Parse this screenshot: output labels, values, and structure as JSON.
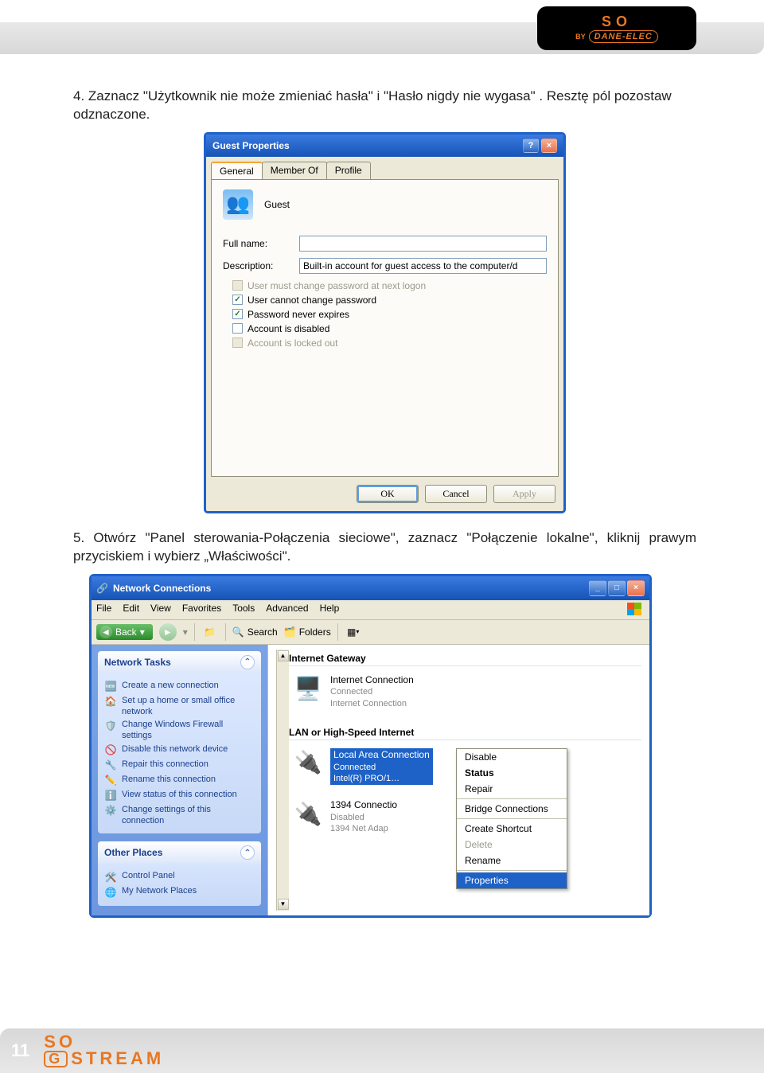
{
  "page_number": "11",
  "header_logo": {
    "so": "SO",
    "by": "BY",
    "brand": "DANE-ELEC"
  },
  "footer_logo": {
    "so": "SO",
    "g": "G",
    "stream": "STREAM"
  },
  "instruction4": "4. Zaznacz \"Użytkownik nie może zmieniać hasła\" i \"Hasło nigdy nie wygasa\" . Resztę pól pozostaw odznaczone.",
  "instruction5": "5. Otwórz \"Panel sterowania-Połączenia sieciowe\", zaznacz \"Połączenie lokalne\", kliknij prawym przyciskiem i wybierz „Właściwości\".",
  "guest_dialog": {
    "title": "Guest Properties",
    "tabs": {
      "general": "General",
      "member": "Member Of",
      "profile": "Profile"
    },
    "user_label": "Guest",
    "full_name_label": "Full name:",
    "full_name_value": "",
    "description_label": "Description:",
    "description_value": "Built-in account for guest access to the computer/d",
    "cb1": "User must change password at next logon",
    "cb2": "User cannot change password",
    "cb3": "Password never expires",
    "cb4": "Account is disabled",
    "cb5": "Account is locked out",
    "ok": "OK",
    "cancel": "Cancel",
    "apply": "Apply"
  },
  "nc": {
    "title": "Network Connections",
    "menu": {
      "file": "File",
      "edit": "Edit",
      "view": "View",
      "favorites": "Favorites",
      "tools": "Tools",
      "advanced": "Advanced",
      "help": "Help"
    },
    "toolbar": {
      "back": "Back",
      "search": "Search",
      "folders": "Folders"
    },
    "tasks_title": "Network Tasks",
    "tasks": [
      "Create a new connection",
      "Set up a home or small office network",
      "Change Windows Firewall settings",
      "Disable this network device",
      "Repair this connection",
      "Rename this connection",
      "View status of this connection",
      "Change settings of this connection"
    ],
    "other_title": "Other Places",
    "other": [
      "Control Panel",
      "My Network Places"
    ],
    "sect1": "Internet Gateway",
    "conn1": {
      "name": "Internet Connection",
      "status": "Connected",
      "type": "Internet Connection"
    },
    "sect2": "LAN or High-Speed Internet",
    "conn2": {
      "name": "Local Area Connection",
      "status": "Connected",
      "type": "Intel(R) PRO/1…"
    },
    "conn3": {
      "name": "1394 Connectio",
      "status": "Disabled",
      "type": "1394 Net Adap"
    },
    "ctx": {
      "disable": "Disable",
      "status": "Status",
      "repair": "Repair",
      "bridge": "Bridge Connections",
      "shortcut": "Create Shortcut",
      "delete": "Delete",
      "rename": "Rename",
      "properties": "Properties"
    }
  }
}
